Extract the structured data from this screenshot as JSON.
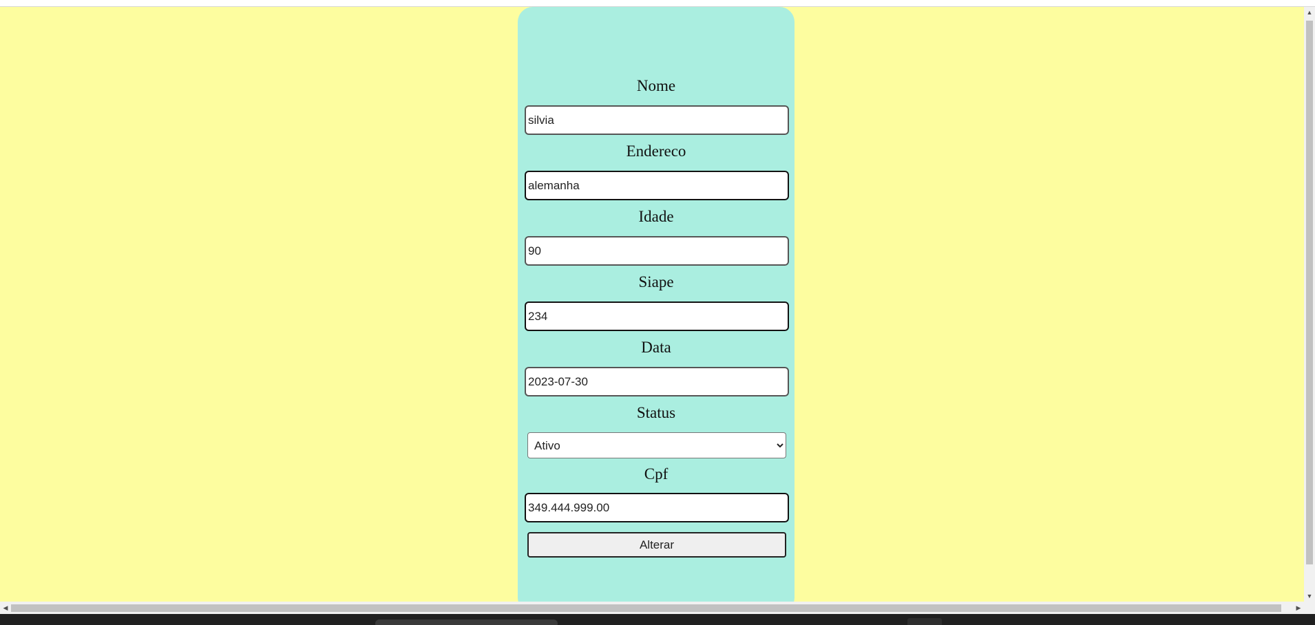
{
  "form": {
    "fields": [
      {
        "label": "Nome",
        "value": "silvia"
      },
      {
        "label": "Endereco",
        "value": "alemanha"
      },
      {
        "label": "Idade",
        "value": "90"
      },
      {
        "label": "Siape",
        "value": "234"
      },
      {
        "label": "Data",
        "value": "2023-07-30"
      }
    ],
    "status": {
      "label": "Status",
      "selected": "Ativo"
    },
    "cpf": {
      "label": "Cpf",
      "value": "349.444.999.00"
    },
    "submit_label": "Alterar"
  },
  "colors": {
    "page_background": "#fdfd9f",
    "card_background": "#aaeee0"
  }
}
